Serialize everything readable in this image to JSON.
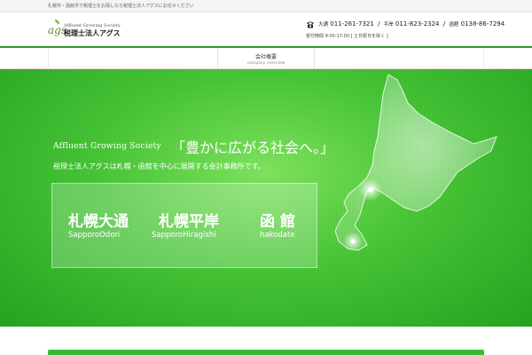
{
  "topbar": {
    "text": "札幌市・函館市で税理士をお探しなら税理士法人アグスにお任せください"
  },
  "logo": {
    "mark": "ags",
    "society": "Affluent Growing Society",
    "name": "税理士法人アグス"
  },
  "contact": {
    "phones": [
      {
        "label": "大通",
        "number": "011-261-7321"
      },
      {
        "label": "平岸",
        "number": "011-823-2324"
      },
      {
        "label": "函館",
        "number": "0138-86-7294"
      }
    ],
    "hours": "受付時間 9:00-17:00 [ 土日祝日を除く ]"
  },
  "nav": {
    "items": [
      {
        "label": "会社概要",
        "sub": "company overview"
      }
    ]
  },
  "hero": {
    "tagline_en": "Affluent Growing Society",
    "tagline_jp": "「豊かに広がる社会へ。」",
    "subline": "税理士法人アグスは札幌・函館を中心に展開する会計事務所です。",
    "offices": [
      {
        "name": "札幌大通",
        "roman": "SapporoOdori"
      },
      {
        "name": "札幌平岸",
        "roman": "SapporoHiragishi"
      },
      {
        "name": "函 館",
        "roman": "hakodate"
      }
    ]
  },
  "colors": {
    "accent": "#2e9c2a",
    "hero_light": "#7be05a",
    "hero_dark": "#22a01c"
  }
}
